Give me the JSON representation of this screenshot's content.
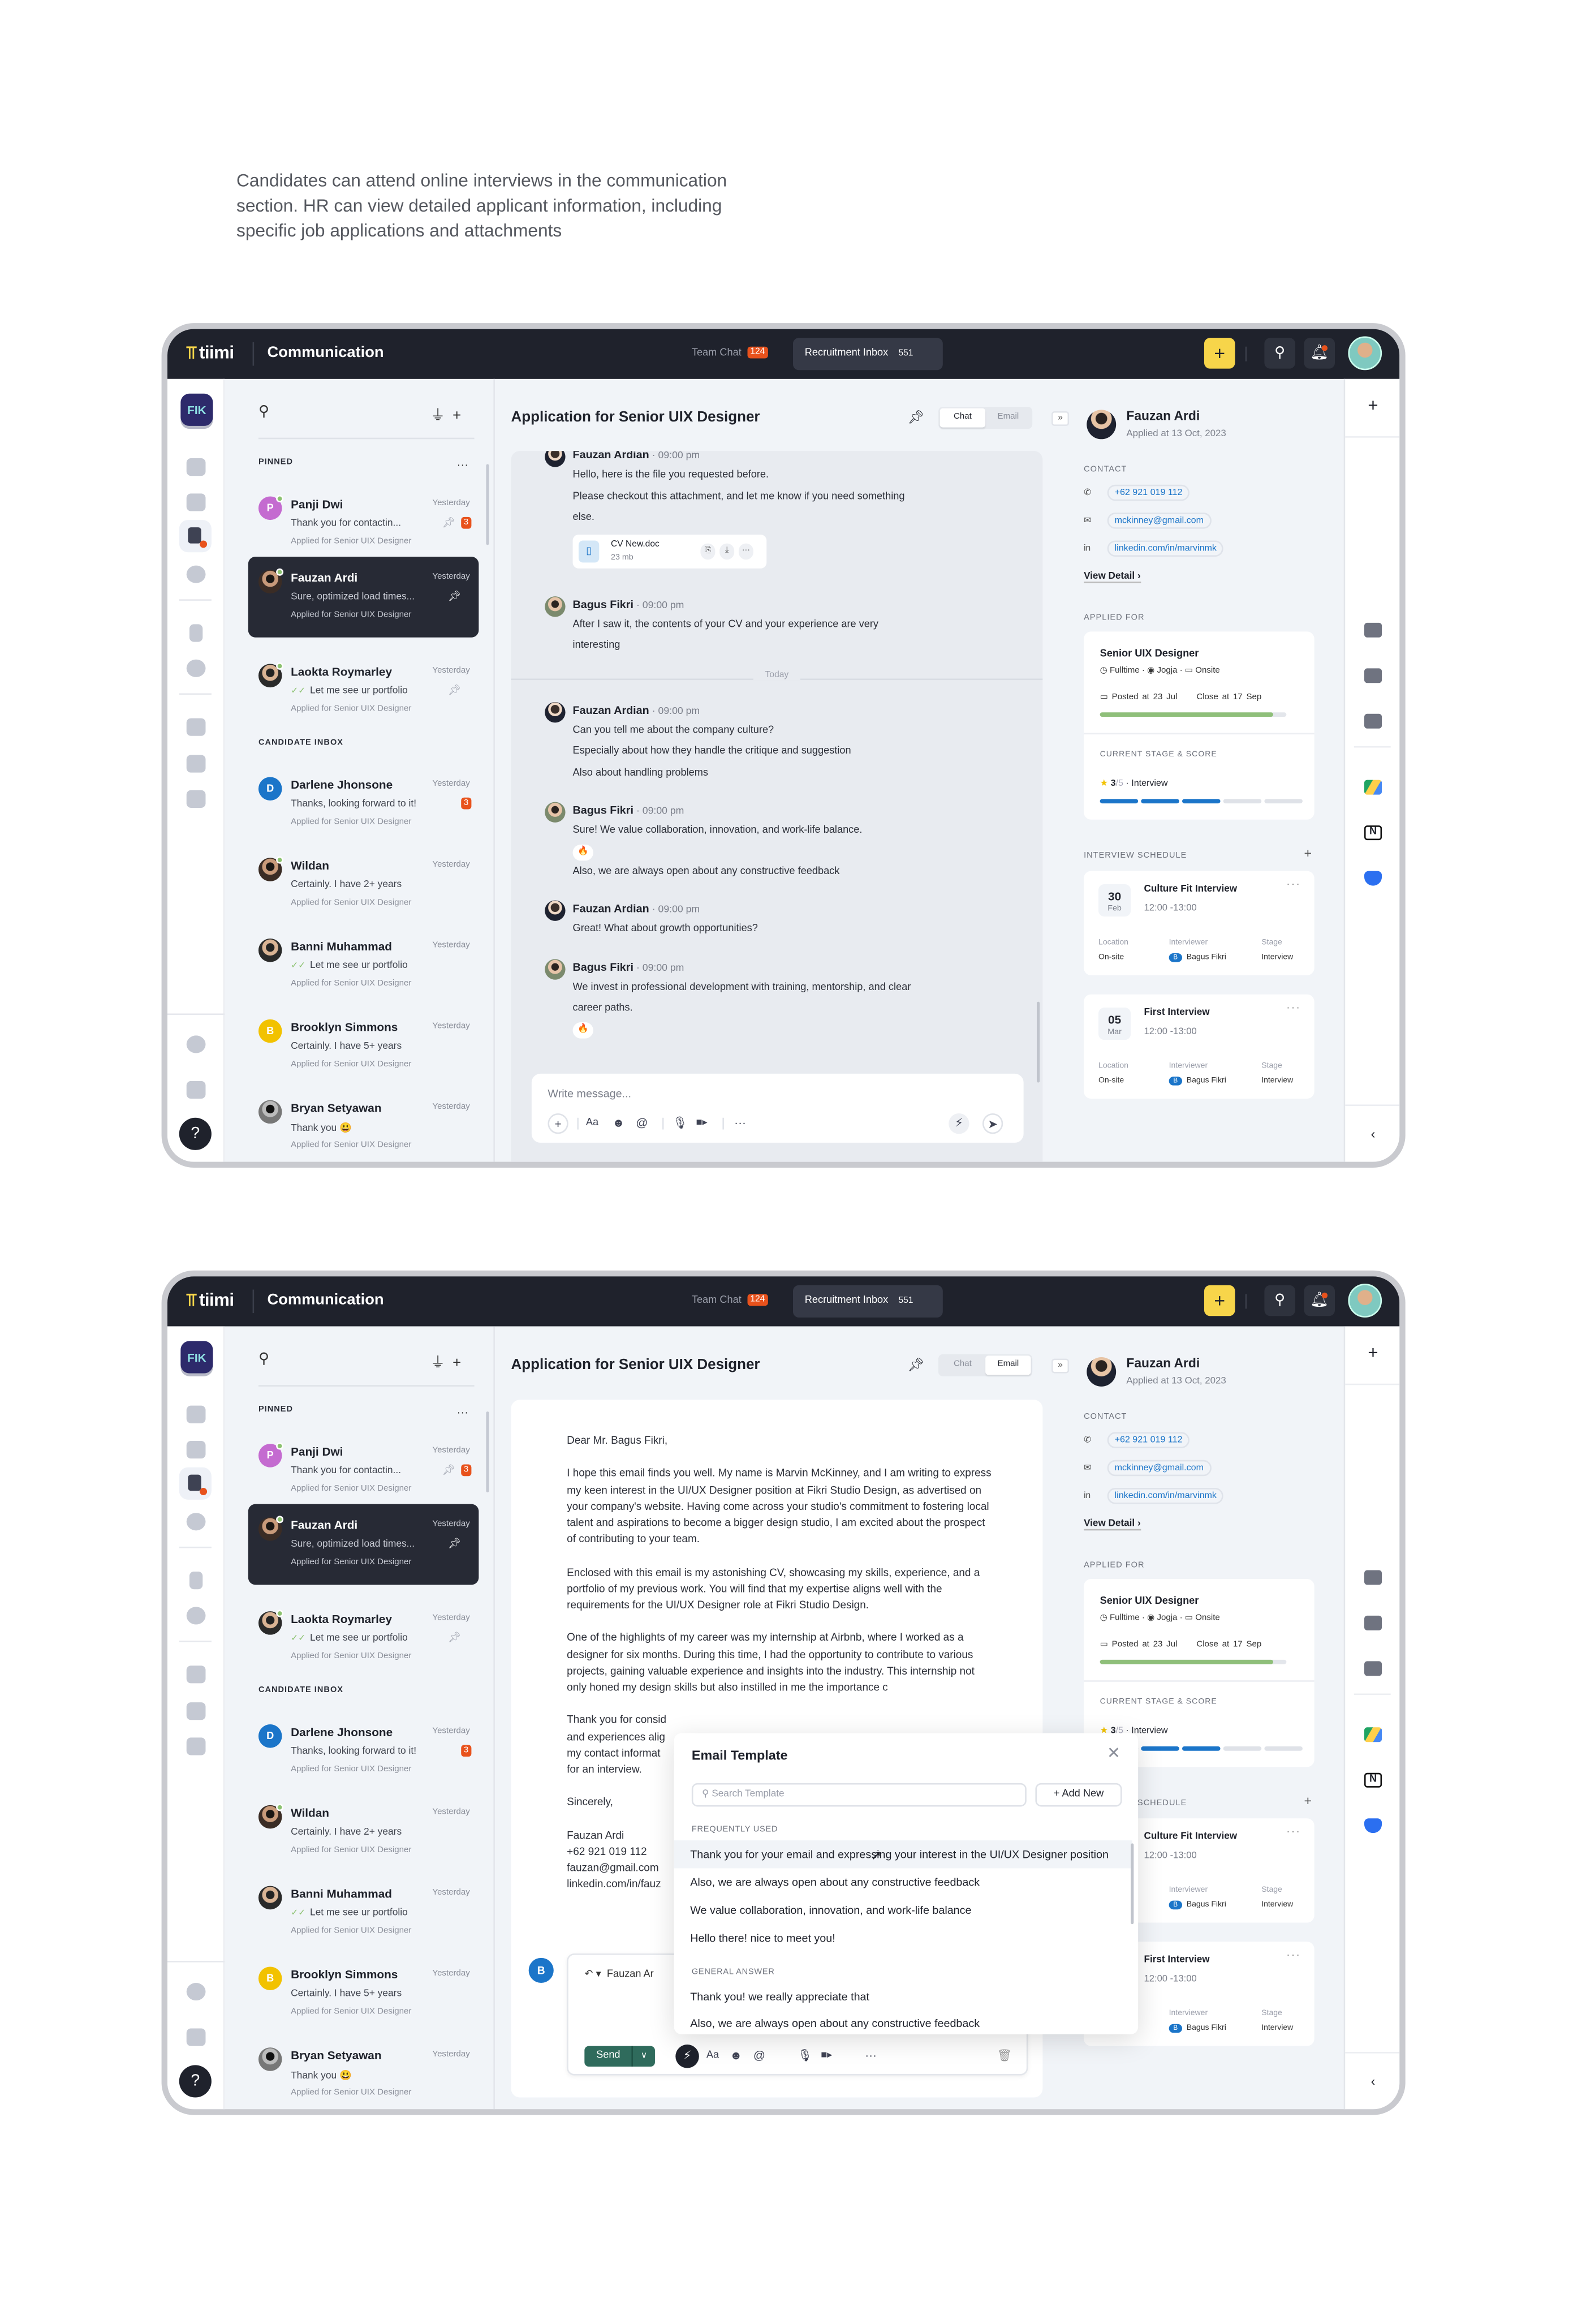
{
  "caption": "Candidates can attend online interviews in the communication section. HR can view detailed applicant information, including specific job applications and attachments",
  "app": {
    "logo": "tiimi",
    "title": "Communication",
    "workspace": "FIK",
    "tabs": [
      {
        "label": "Team Chat",
        "badge": "124"
      },
      {
        "label": "Recruitment Inbox",
        "badge": "551"
      }
    ],
    "add_button": "+",
    "help": "?"
  },
  "list": {
    "pinned_label": "PINNED",
    "inbox_label": "CANDIDATE INBOX",
    "pinned": [
      {
        "name": "Panji Dwi",
        "time": "Yesterday",
        "preview": "Thank you for contactin...",
        "applied": "Applied for Senior UIX Designer",
        "initial": "P",
        "color": "#c46bd0",
        "online": true,
        "pinned": true,
        "unread": "3"
      },
      {
        "name": "Fauzan Ardi",
        "time": "Yesterday",
        "preview": "Sure, optimized load times...",
        "applied": "Applied for Senior UIX Designer",
        "online": true,
        "pinned": true,
        "selected": true
      },
      {
        "name": "Laokta Roymarley",
        "time": "Yesterday",
        "preview": "Let me see ur portfolio",
        "applied": "Applied for Senior UIX Designer",
        "online": true,
        "pinned": true,
        "read": true
      }
    ],
    "inbox": [
      {
        "name": "Darlene Jhonsone",
        "time": "Yesterday",
        "preview": "Thanks, looking forward to it!",
        "applied": "Applied for Senior UIX Designer",
        "initial": "D",
        "color": "#1b75c9",
        "unread": "3"
      },
      {
        "name": "Wildan",
        "time": "Yesterday",
        "preview": "Certainly. I have 2+ years",
        "applied": "Applied for Senior UIX Designer",
        "online": true
      },
      {
        "name": "Banni Muhammad",
        "time": "Yesterday",
        "preview": "Let me see ur portfolio",
        "applied": "Applied for Senior UIX Designer",
        "read": true
      },
      {
        "name": "Brooklyn Simmons",
        "time": "Yesterday",
        "preview": "Certainly. I have 5+ years",
        "applied": "Applied for Senior UIX Designer",
        "initial": "B",
        "color": "#f2c200"
      },
      {
        "name": "Bryan Setyawan",
        "time": "Yesterday",
        "preview": "Thank you 😃",
        "applied": "Applied for Senior UIX Designer"
      }
    ]
  },
  "conversation": {
    "title": "Application for Senior UIX Designer",
    "toggle": {
      "chat": "Chat",
      "email": "Email"
    }
  },
  "chat": {
    "divider": "Today",
    "attachment": {
      "name": "CV New.doc",
      "size": "23 mb"
    },
    "input_placeholder": "Write message...",
    "messages": [
      {
        "author": "Fauzan Ardian",
        "time": "· 09:00 pm",
        "lines": [
          "Hello, here is the file you requested before.",
          "Please checkout this attachment, and let me know if you need something else."
        ],
        "attachment": true
      },
      {
        "author": "Bagus Fikri",
        "time": "· 09:00 pm",
        "lines": [
          "After I saw it, the contents of your CV and your experience are very interesting"
        ],
        "divider_after": true
      },
      {
        "author": "Fauzan Ardian",
        "time": "· 09:00 pm",
        "lines": [
          "Can you tell me about the company culture?",
          "Especially about how they handle the critique and suggestion",
          "Also about handling problems"
        ]
      },
      {
        "author": "Bagus Fikri",
        "time": "· 09:00 pm",
        "lines": [
          "Sure! We value collaboration, innovation, and work-life balance.",
          "🔥",
          "Also, we are always open about any constructive feedback"
        ]
      },
      {
        "author": "Fauzan Ardian",
        "time": "· 09:00 pm",
        "lines": [
          "Great! What about growth opportunities?"
        ]
      },
      {
        "author": "Bagus Fikri",
        "time": "· 09:00 pm",
        "lines": [
          "We invest in professional development with training, mentorship, and clear career paths.",
          "🔥"
        ]
      }
    ]
  },
  "candidate": {
    "name": "Fauzan Ardi",
    "applied_at": "Applied at 13 Oct, 2023",
    "contact_label": "CONTACT",
    "phone": "+62 921 019 112",
    "email": "mckinney@gmail.com",
    "linkedin": "linkedin.com/in/marvinmk",
    "view_detail": "View Detail",
    "applied_for_label": "APPLIED FOR",
    "job": {
      "title": "Senior UIX Designer",
      "type": "Fulltime",
      "location": "Jogja",
      "mode": "Onsite",
      "posted": "Posted at 23 Jul",
      "close": "Close at 17 Sep",
      "progress": 0.93
    },
    "stage_label": "CURRENT STAGE & SCORE",
    "score": "3",
    "score_max": "/5",
    "stage": "Interview",
    "stage_step": 3,
    "stage_total": 5,
    "schedule_label": "INTERVIEW SCHEDULE",
    "interviews": [
      {
        "day": "30",
        "month": "Feb",
        "title": "Culture Fit Interview",
        "time": "12:00 -13:00",
        "location_label": "Location",
        "location": "On-site",
        "interviewer_label": "Interviewer",
        "interviewer": "Bagus Fikri",
        "stage_label": "Stage",
        "stage": "Interview"
      },
      {
        "day": "05",
        "month": "Mar",
        "title": "First Interview",
        "time": "12:00 -13:00",
        "location_label": "Location",
        "location": "On-site",
        "interviewer_label": "Interviewer",
        "interviewer": "Bagus Fikri",
        "stage_label": "Stage",
        "stage": "Interview"
      }
    ]
  },
  "email": {
    "greeting": "Dear Mr. Bagus Fikri,",
    "paragraphs": [
      "I hope this email finds you well. My name is Marvin McKinney, and I am writing to express my keen interest in the UI/UX Designer position at Fikri Studio Design, as advertised on your company's website. Having come across your studio's commitment to fostering local talent and aspirations to become a bigger design studio, I am excited about the prospect of contributing to your team.",
      "Enclosed with this email is my astonishing CV, showcasing my skills, experience, and a portfolio of my previous work. You will find that my expertise aligns well with the requirements for the UI/UX Designer role at Fikri Studio Design.",
      "One of the highlights of my career was my internship at Airbnb, where I worked as a designer for six months. During this time, I had the opportunity to contribute to various projects, gaining valuable experience and insights into the industry. This internship not only honed my design skills but also instilled in me the importance c"
    ],
    "closing_lines": [
      "Thank you for consid",
      "and experiences alig",
      "my contact informat",
      "for an interview."
    ],
    "signoff": "Sincerely,",
    "signature": [
      "Fauzan Ardi",
      "+62 921 019 112",
      "fauzan@gmail.com",
      "linkedin.com/in/fauz"
    ],
    "composer": {
      "avatar": "B",
      "recipient": "Fauzan Ar",
      "send": "Send"
    }
  },
  "template": {
    "title": "Email Template",
    "search_placeholder": "Search Template",
    "add_new": "Add New",
    "frequent_label": "FREQUENTLY USED",
    "frequent": [
      "Thank you for your email and expressing your interest in the UI/UX Designer position",
      "Also, we are always open about any constructive feedback",
      "We value collaboration, innovation, and work-life balance",
      "Hello there! nice to meet you!"
    ],
    "general_label": "GENERAL ANSWER",
    "general": [
      "Thank you! we really appreciate that",
      "Also, we are always open about any constructive feedback"
    ]
  },
  "colors": {
    "header": "#1f222c",
    "accent": "#1b75c9",
    "badge": "#e8521c",
    "add": "#f7d54a",
    "send": "#2f6b5c",
    "progress": "#8fbf7a"
  }
}
